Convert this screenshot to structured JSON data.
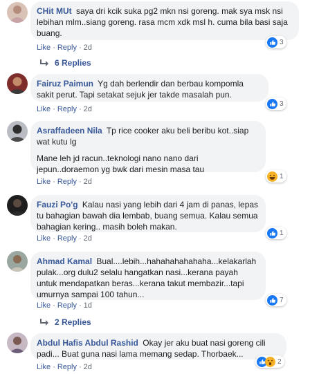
{
  "comments": [
    {
      "author": "CHit MUt",
      "text": "saya dri kcik suka pg2 mkn nsi goreng. mak sya msk nsi lebihan mlm..siang goreng. rasa mcm xdk msl h. cuma bila basi saja buang.",
      "like": "Like",
      "reply": "Reply",
      "time": "2d",
      "reaction_count": "3",
      "reaction_icon": "like-icon"
    },
    {
      "author": "Fairuz Paimun",
      "text": "Yg dah berlendir dan berbau kompomla sakit perut. Tapi setakat sejuk jer takde masalah pun.",
      "like": "Like",
      "reply": "Reply",
      "time": "2d",
      "reaction_count": "3",
      "reaction_icon": "like-icon"
    },
    {
      "author": "Asraffadeen Nila",
      "text": "Tp rice cooker aku beli beribu kot..siap wat kutu lg",
      "text2": "Mane leh jd racun..teknologi nano nano dari jepun..doraemon yg bwk dari mesin masa tau",
      "like": "Like",
      "reply": "Reply",
      "time": "2d",
      "reaction_count": "1",
      "reaction_icon": "haha-icon"
    },
    {
      "author": "Fauzi Po'g",
      "text": "Kalau nasi yang lebih dari 4 jam di panas, lepas tu bahagian bawah dia lembab, buang semua. Kalau semua bahagian kering.. masih boleh makan.",
      "like": "Like",
      "reply": "Reply",
      "time": "2d",
      "reaction_count": "1",
      "reaction_icon": "like-icon"
    },
    {
      "author": "Ahmad Kamal",
      "text": "Bual....lebih...hahahahahahaha...kelakarlah pulak...org dulu2 selalu hangatkan nasi...kerana payah untuk mendapatkan beras...kerana takut membazir...tapi umurnya sampai 100 tahun...",
      "like": "Like",
      "reply": "Reply",
      "time": "1d",
      "reaction_count": "7",
      "reaction_icon": "like-icon"
    },
    {
      "author": "Abdul Hafis Abdul Rashid",
      "text": "Okay jer aku buat nasi goreng cili padi... Buat guna nasi lama memang sedap. Thorbaek...",
      "like": "Like",
      "reply": "Reply",
      "time": "2d",
      "reaction_count": "2",
      "reaction_icon": "like-icon"
    }
  ],
  "replies": [
    {
      "label": "6 Replies"
    },
    {
      "label": "2 Replies"
    }
  ],
  "colors": {
    "link": "#385898",
    "bubble": "#f2f3f5",
    "meta": "#606770",
    "like_blue": "#1877f2",
    "haha_yellow": "#f7b125"
  }
}
